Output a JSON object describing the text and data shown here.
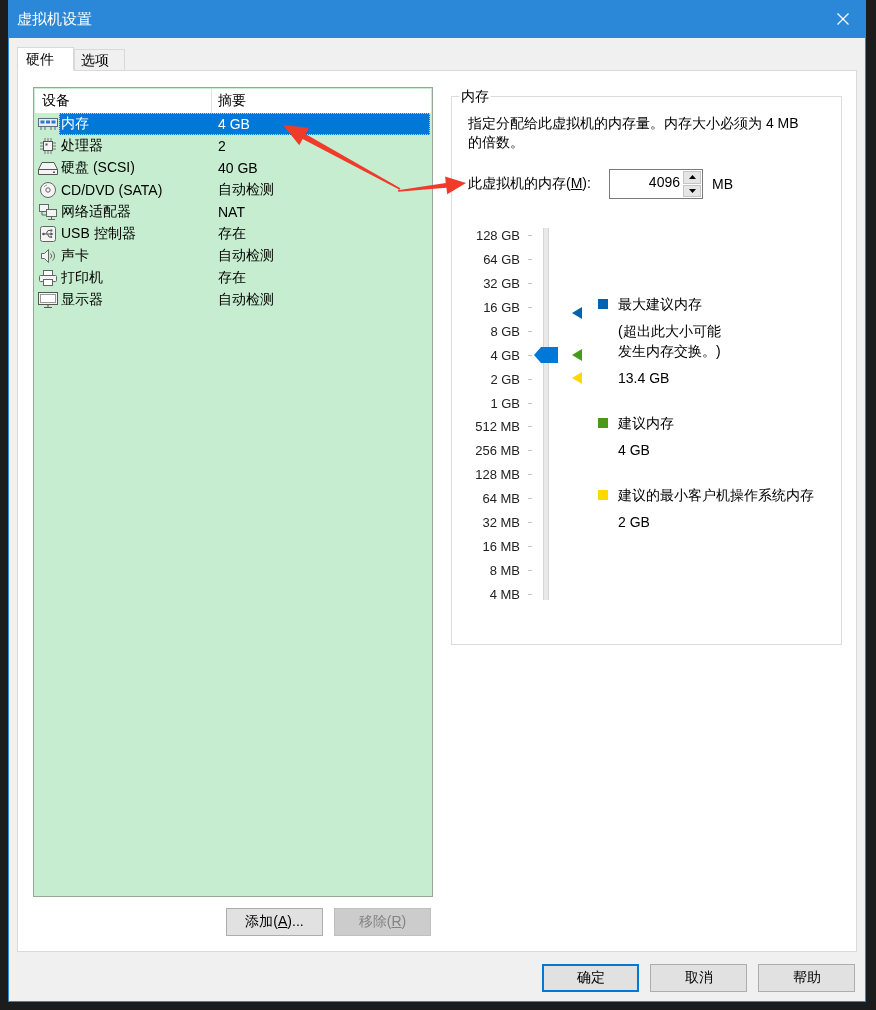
{
  "window": {
    "title": "虚拟机设置"
  },
  "tabs": [
    {
      "label": "硬件",
      "selected": true
    },
    {
      "label": "选项",
      "selected": false
    }
  ],
  "devices": {
    "columns": [
      "设备",
      "摘要"
    ],
    "rows": [
      {
        "kind": "memory",
        "name": "内存",
        "summary": "4 GB",
        "selected": true
      },
      {
        "kind": "processor",
        "name": "处理器",
        "summary": "2",
        "selected": false
      },
      {
        "kind": "hard_disk",
        "name": "硬盘 (SCSI)",
        "summary": "40 GB",
        "selected": false
      },
      {
        "kind": "cd_dvd",
        "name": "CD/DVD (SATA)",
        "summary": "自动检测",
        "selected": false
      },
      {
        "kind": "network",
        "name": "网络适配器",
        "summary": "NAT",
        "selected": false
      },
      {
        "kind": "usb",
        "name": "USB 控制器",
        "summary": "存在",
        "selected": false
      },
      {
        "kind": "sound",
        "name": "声卡",
        "summary": "自动检测",
        "selected": false
      },
      {
        "kind": "printer",
        "name": "打印机",
        "summary": "存在",
        "selected": false
      },
      {
        "kind": "display",
        "name": "显示器",
        "summary": "自动检测",
        "selected": false
      }
    ]
  },
  "device_buttons": [
    {
      "label": "添加(",
      "access_key": "A",
      "label_end": ")...",
      "disabled": false
    },
    {
      "label": "移除(",
      "access_key": "R",
      "label_end": ")",
      "disabled": true
    }
  ],
  "memory": {
    "title": "内存",
    "description": "指定分配给此虚拟机的内存量。内存大小必须为 4 MB 的倍数。",
    "field": {
      "label": "此虚拟机的内存(",
      "access_key": "M",
      "label_end": "):",
      "value": "4096",
      "unit": "MB"
    },
    "scale": [
      "128 GB",
      "64 GB",
      "32 GB",
      "16 GB",
      "8 GB",
      "4 GB",
      "2 GB",
      "1 GB",
      "512 MB",
      "256 MB",
      "128 MB",
      "64 MB",
      "32 MB",
      "16 MB",
      "8 MB",
      "4 MB"
    ],
    "slider": {
      "level": 0.6667,
      "markers": [
        {
          "color": "#0063b1",
          "level": 0.783
        },
        {
          "color": "#4a9a1a",
          "level": 0.6667
        },
        {
          "color": "#ffd800",
          "level": 0.6
        }
      ]
    },
    "legend": [
      {
        "title": "最大建议内存",
        "note": "(超出此大小可能发生内存交换。)",
        "value": "13.4 GB",
        "color": "#0063b1"
      },
      {
        "title": "建议内存",
        "value": "4 GB",
        "color": "#4a9a1a"
      },
      {
        "title": "建议的最小客户机操作系统内存",
        "value": "2 GB",
        "color": "#ffd800"
      }
    ]
  },
  "buttons": [
    {
      "label": "确定",
      "default": true
    },
    {
      "label": "取消",
      "default": false
    },
    {
      "label": "帮助",
      "default": false
    }
  ],
  "annotations": [
    {
      "kind": "arrow"
    },
    {
      "kind": "arrow"
    }
  ]
}
